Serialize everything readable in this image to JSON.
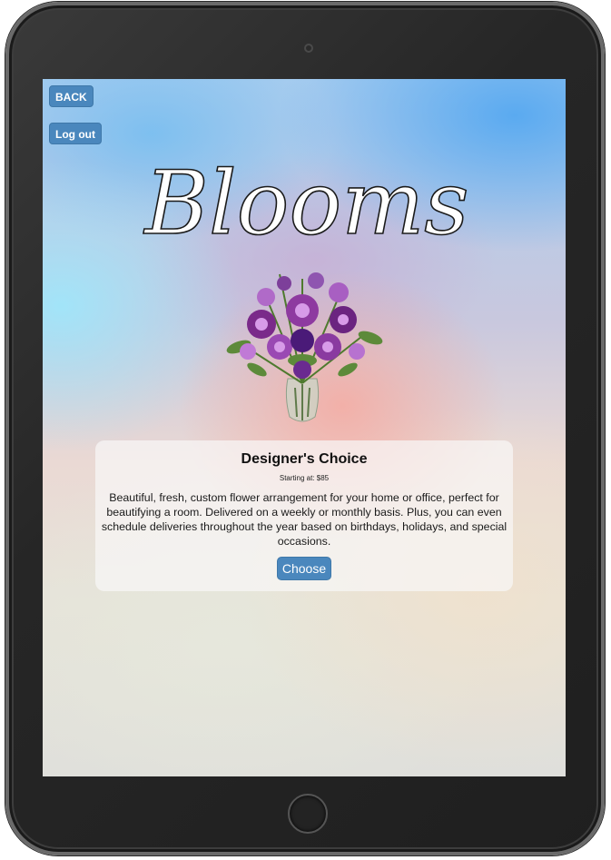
{
  "nav": {
    "back_label": "BACK",
    "logout_label": "Log out"
  },
  "brand": {
    "logo_text": "Blooms"
  },
  "product": {
    "title": "Designer's Choice",
    "price_text": "Starting at: $85",
    "description": "Beautiful, fresh, custom flower arrangement for your home or office, perfect for beautifying a room. Delivered on a weekly or monthly basis. Plus, you can even schedule deliveries throughout the year based on birthdays, holidays, and special occasions.",
    "choose_label": "Choose",
    "image": "purple-flower-bouquet-in-vase"
  },
  "colors": {
    "button_bg": "#4a87bd",
    "device_frame": "#262626"
  }
}
